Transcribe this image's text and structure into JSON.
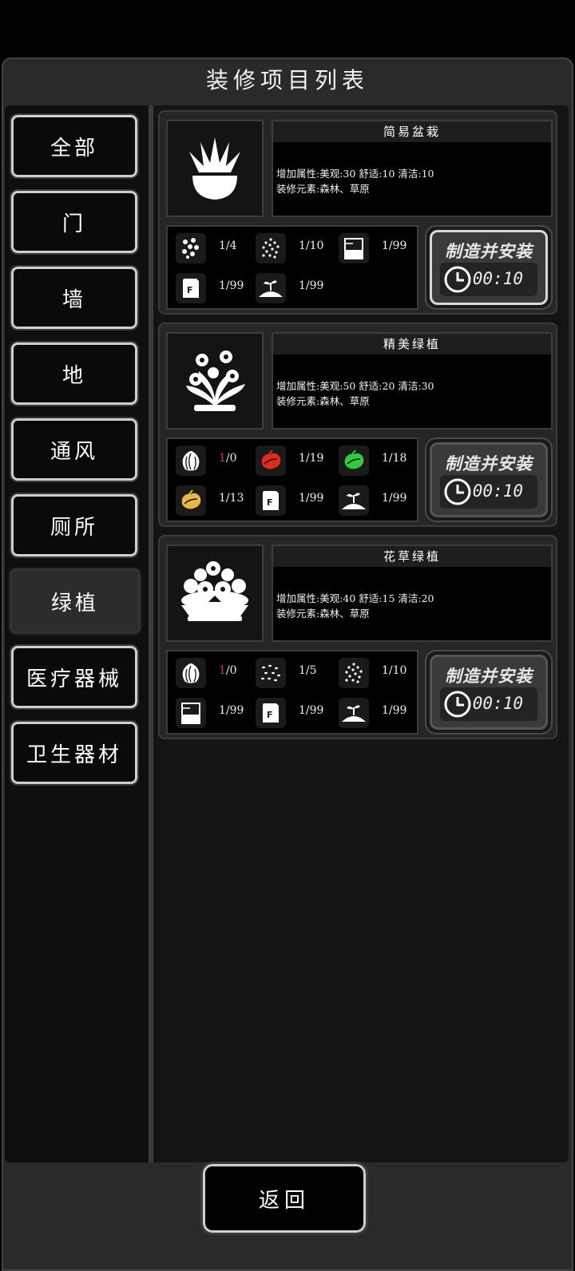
{
  "header": {
    "title": "装修项目列表"
  },
  "categories": [
    {
      "label": "全部",
      "active": false
    },
    {
      "label": "门",
      "active": false
    },
    {
      "label": "墙",
      "active": false
    },
    {
      "label": "地",
      "active": false
    },
    {
      "label": "通风",
      "active": false
    },
    {
      "label": "厕所",
      "active": false
    },
    {
      "label": "绿植",
      "active": true
    },
    {
      "label": "医疗器械",
      "active": false
    },
    {
      "label": "卫生器材",
      "active": false
    }
  ],
  "items": [
    {
      "name": "简易盆栽",
      "attributes": "增加属性:美观:30 舒适:10 清洁:10",
      "elements": "装修元素:森林、草原",
      "icon": "potted-plant-icon",
      "materials": [
        {
          "icon": "flower-seeds-icon",
          "have": "1",
          "need": "/4",
          "low": false
        },
        {
          "icon": "seeds-icon",
          "have": "1",
          "need": "/10",
          "low": false
        },
        {
          "icon": "jar-icon",
          "have": "1",
          "need": "/99",
          "low": false
        },
        {
          "icon": "fertilizer-bag-icon",
          "have": "1",
          "need": "/99",
          "low": false
        },
        {
          "icon": "soil-sprout-icon",
          "have": "1",
          "need": "/99",
          "low": false
        }
      ],
      "button": {
        "label": "制造并安装",
        "time": "00:10",
        "enabled": true
      }
    },
    {
      "name": "精美绿植",
      "attributes": "增加属性:美观:50 舒适:20 清洁:30",
      "elements": "装修元素:森林、草原",
      "icon": "flower-bush-icon",
      "materials": [
        {
          "icon": "garlic-icon",
          "have": "1",
          "need": "/0",
          "low": true
        },
        {
          "icon": "red-fruit-icon",
          "have": "1",
          "need": "/19",
          "low": false
        },
        {
          "icon": "green-fruit-icon",
          "have": "1",
          "need": "/18",
          "low": false
        },
        {
          "icon": "yellow-fruit-icon",
          "have": "1",
          "need": "/13",
          "low": false
        },
        {
          "icon": "fertilizer-bag-icon",
          "have": "1",
          "need": "/99",
          "low": false
        },
        {
          "icon": "soil-sprout-icon",
          "have": "1",
          "need": "/99",
          "low": false
        }
      ],
      "button": {
        "label": "制造并安装",
        "time": "00:10",
        "enabled": false
      }
    },
    {
      "name": "花草绿植",
      "attributes": "增加属性:美观:40 舒适:15 清洁:20",
      "elements": "装修元素:森林、草原",
      "icon": "flower-planter-icon",
      "materials": [
        {
          "icon": "garlic-icon",
          "have": "1",
          "need": "/0",
          "low": true
        },
        {
          "icon": "scattered-seeds-icon",
          "have": "1",
          "need": "/5",
          "low": false
        },
        {
          "icon": "seeds-icon",
          "have": "1",
          "need": "/10",
          "low": false
        },
        {
          "icon": "jar-icon",
          "have": "1",
          "need": "/99",
          "low": false
        },
        {
          "icon": "fertilizer-bag-icon",
          "have": "1",
          "need": "/99",
          "low": false
        },
        {
          "icon": "soil-sprout-icon",
          "have": "1",
          "need": "/99",
          "low": false
        }
      ],
      "button": {
        "label": "制造并安装",
        "time": "00:10",
        "enabled": false
      }
    }
  ],
  "footer": {
    "back_label": "返回"
  },
  "colors": {
    "red_fruit": "#e22a1e",
    "green_fruit": "#2ecc40",
    "yellow_fruit": "#e8b844",
    "low_count": "#d43a3a"
  }
}
